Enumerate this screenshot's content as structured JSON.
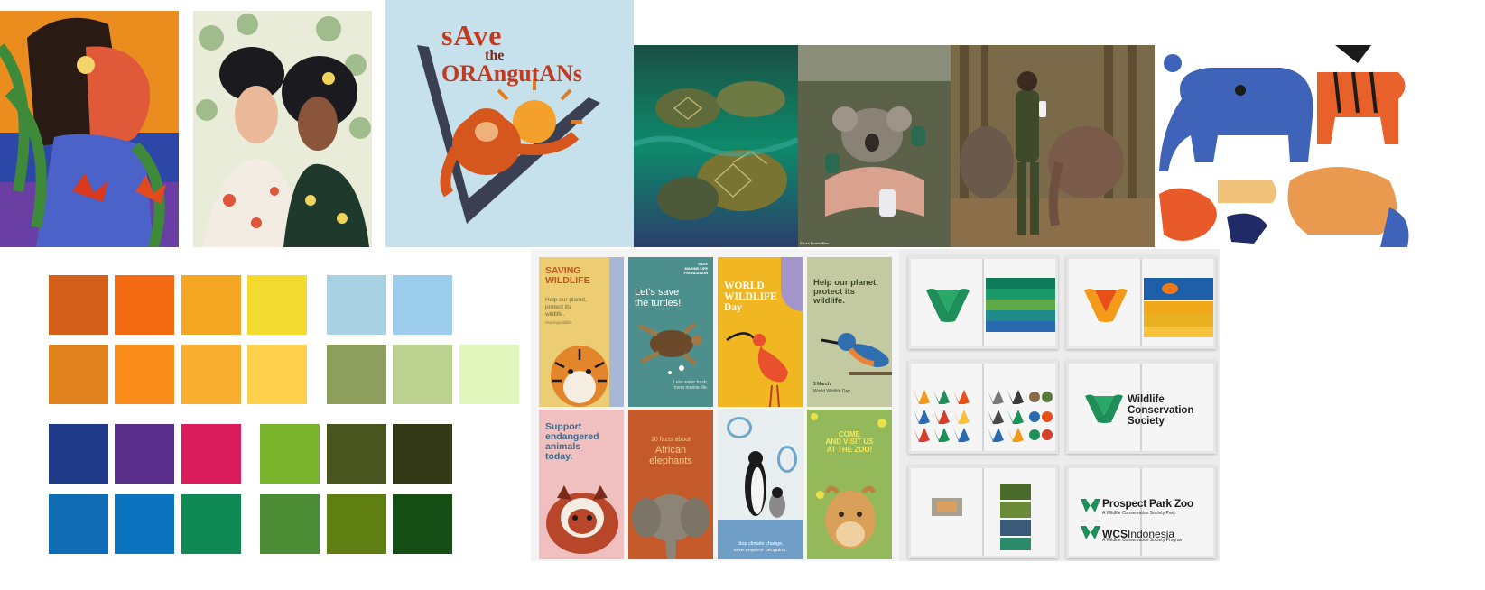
{
  "art": {
    "orangutan": {
      "line1": "sAve",
      "line2": "the",
      "line3": "ORAngutANs"
    },
    "photo_credit": "© Lee Fowler/Bas"
  },
  "palette": {
    "warm_row1": [
      "#d4601c",
      "#f36a13",
      "#f5a623",
      "#f3dc2f"
    ],
    "warm_row2": [
      "#e2821f",
      "#f98c1a",
      "#f8ae2e",
      "#fcd04a"
    ],
    "blue_pair": [
      "#a8d2e4",
      "#9ccdeb"
    ],
    "green_row": [
      "#8e9e5c",
      "#bcd18f",
      "#e0f6bd"
    ],
    "cool_row1": [
      "#1e3a86",
      "#5a2f8c",
      "#da1c5c"
    ],
    "cool_row2": [
      "#0f6bb4",
      "#0c73bf",
      "#0f8a55"
    ],
    "greens_row1": [
      "#79b42c",
      "#48551f",
      "#343a18"
    ],
    "greens_row2": [
      "#4b8c34",
      "#5f7f12",
      "#154d15"
    ]
  },
  "posters": [
    {
      "title": "SAVING\nWILDLIFE",
      "body": "Help our planet,\nprotect its\nwildlife.",
      "tag": "#savingwildlife"
    },
    {
      "kicker": "SAVE\nMARINE LIFE\nFOUNDATION",
      "title": "Let's save\nthe turtles!",
      "body": "Less water trash,\nmore marine life."
    },
    {
      "title": "WORLD\nWILDLIFE\nDay"
    },
    {
      "title": "Help our planet,\nprotect its\nwildlife.",
      "date": "3 March",
      "event": "World Wildlife Day"
    },
    {
      "title": "Support\nendangered\nanimals\ntoday."
    },
    {
      "kicker": "10 facts about",
      "title": "African\nelephants"
    },
    {
      "body": "Stop climate change,\nsave emperor penguins."
    },
    {
      "title": "COME\nAND VISIT US\nAT THE ZOO!"
    }
  ],
  "brand": {
    "wordmark": "Wildlife\nConservation\nSociety",
    "ppz_name": "Prospect Park Zoo",
    "ppz_sub": "A Wildlife Conservation Society Park",
    "wcs_abbr": "WCS",
    "wcs_country": "Indonesia",
    "wcs_sub": "A Wildlife Conservation Society Program"
  },
  "colors": {
    "wcs_green": "#1f8f5a",
    "wcs_teal": "#1f7a7a"
  }
}
